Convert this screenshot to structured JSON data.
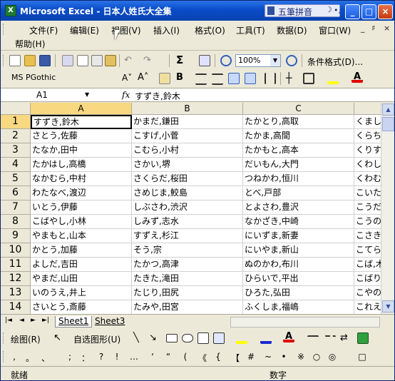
{
  "window": {
    "title": "Microsoft Excel - 日本人姓氏大全集",
    "ime_label": "五筆拼音",
    "ime_moon": "☽",
    "ime_dot": "•,",
    "min": "_",
    "max": "□",
    "close": "×"
  },
  "menu": {
    "items": [
      "文件(F)",
      "编辑(E)",
      "视图(V)",
      "插入(I)",
      "格式(O)",
      "工具(T)",
      "数据(D)",
      "窗口(W)"
    ],
    "help": "帮助(H)",
    "doc_controls": [
      "_",
      "♯",
      "×"
    ]
  },
  "toolbar": {
    "zoom": "100%",
    "conditional_format": "条件格式(D)...",
    "font_name": "MS PGothic",
    "sum": "Σ"
  },
  "formula_bar": {
    "cell_ref": "A1",
    "fx": "fx",
    "value": "すずき,鈴木"
  },
  "grid": {
    "columns": [
      "A",
      "B",
      "C",
      ""
    ],
    "rows": [
      {
        "n": "1",
        "cells": [
          "すずき,鈴木",
          "かまだ,鎌田",
          "たかとり,高取",
          "くまし,熊"
        ]
      },
      {
        "n": "2",
        "cells": [
          "さとう,佐藤",
          "こすげ,小菅",
          "たかま,高間",
          "くらち,倉"
        ]
      },
      {
        "n": "3",
        "cells": [
          "たなか,田中",
          "こむら,小村",
          "たかもと,高本",
          "くりす,栗"
        ]
      },
      {
        "n": "4",
        "cells": [
          "たかはし,高橋",
          "さかい,堺",
          "だいもん,大門",
          "くわしま"
        ]
      },
      {
        "n": "5",
        "cells": [
          "なかむら,中村",
          "さくらだ,桜田",
          "つねかわ,恒川",
          "くわむ"
        ]
      },
      {
        "n": "6",
        "cells": [
          "わたなべ,渡辺",
          "さめじま,鮫島",
          "とべ,戸部",
          "こいた,"
        ]
      },
      {
        "n": "7",
        "cells": [
          "いとう,伊藤",
          "しぶさわ,渋沢",
          "とよさわ,豊沢",
          "こうだ,"
        ]
      },
      {
        "n": "8",
        "cells": [
          "こばやし,小林",
          "しみず,志水",
          "なかざき,中崎",
          "こうの,"
        ]
      },
      {
        "n": "9",
        "cells": [
          "やまもと,山本",
          "すずえ,杉江",
          "にいずま,新妻",
          "こさき,"
        ]
      },
      {
        "n": "10",
        "cells": [
          "かとう,加藤",
          "そう,宗",
          "にいやま,新山",
          "こてら,"
        ]
      },
      {
        "n": "11",
        "cells": [
          "よしだ,吉田",
          "たかつ,高津",
          "ぬのかわ,布川",
          "こば,木"
        ]
      },
      {
        "n": "12",
        "cells": [
          "やまだ,山田",
          "たきた,滝田",
          "ひらいで,平出",
          "こばり"
        ]
      },
      {
        "n": "13",
        "cells": [
          "いのうえ,井上",
          "たじり,田尻",
          "ひろた,弘田",
          "こやの"
        ]
      },
      {
        "n": "14",
        "cells": [
          "さいとう,斎藤",
          "たみや,田宮",
          "ふくしま,福嶋",
          "これえ"
        ]
      },
      {
        "n": "15",
        "cells": [
          "はやし,林",
          "てらさき,寺崎",
          "ふくにし,福西",
          "こんご"
        ]
      },
      {
        "n": "16",
        "cells": [
          "きむら,木村",
          "ながお,長尾",
          "ふたつぎ,二木",
          "ごしま"
        ]
      }
    ]
  },
  "sheets": {
    "nav": [
      "|◄",
      "◄",
      "►",
      "►|"
    ],
    "tabs": [
      "Sheet1",
      "Sheet3"
    ]
  },
  "drawing": {
    "draw_label": "绘图(R)",
    "autoshape_label": "自选图形(U)"
  },
  "symbols": [
    ",",
    "。",
    "、",
    ";",
    "：",
    "?",
    "!",
    "…",
    "‘",
    "“",
    "(",
    "《",
    "{",
    "【",
    "#",
    "~",
    "•",
    "※",
    "○",
    "◎",
    "□"
  ],
  "status": {
    "left": "就绪",
    "right": "数字"
  },
  "colors": {
    "title_bar": "#0a4cc8",
    "chrome": "#ece9d8",
    "highlight_fill": "#ffff00",
    "font_color": "#e00000"
  }
}
